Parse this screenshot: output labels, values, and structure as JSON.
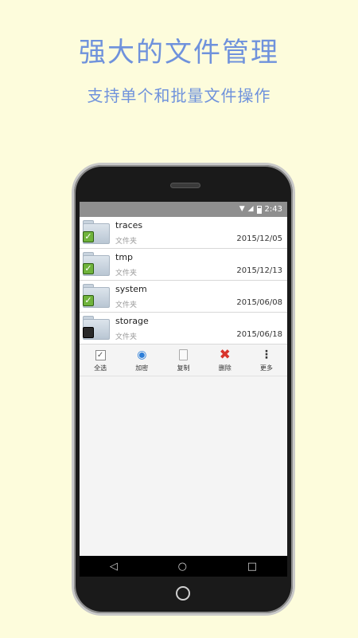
{
  "promo": {
    "headline": "强大的文件管理",
    "subline": "支持单个和批量文件操作"
  },
  "statusbar": {
    "time": "2:43",
    "icons": [
      "wifi-icon",
      "signal-icon",
      "battery-icon"
    ]
  },
  "files": [
    {
      "name": "traces",
      "type": "文件夹",
      "date": "2015/12/05",
      "checked": true
    },
    {
      "name": "tmp",
      "type": "文件夹",
      "date": "2015/12/13",
      "checked": true
    },
    {
      "name": "system",
      "type": "文件夹",
      "date": "2015/06/08",
      "checked": true
    },
    {
      "name": "storage",
      "type": "文件夹",
      "date": "2015/06/18",
      "checked": false
    }
  ],
  "toolbar": {
    "select_all": "全选",
    "encrypt": "加密",
    "copy": "复制",
    "delete": "删除",
    "more": "更多"
  },
  "colors": {
    "background": "#fdfcdc",
    "headline": "#6f92dc",
    "check": "#6fb33c",
    "delete": "#d8352c",
    "encrypt": "#2d7ed8"
  }
}
